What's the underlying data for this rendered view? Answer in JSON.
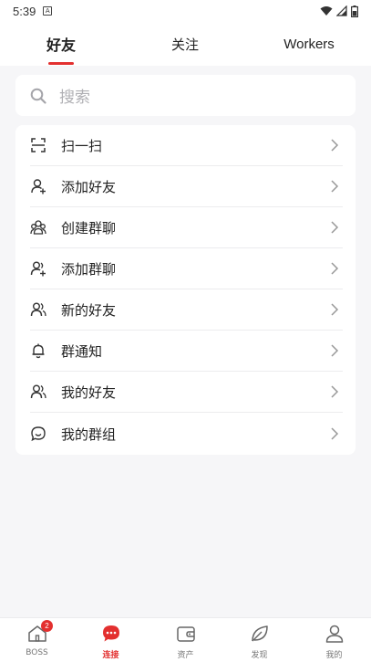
{
  "status_bar": {
    "time": "5:39",
    "notification_glyph": "A"
  },
  "tabs": [
    {
      "label": "好友",
      "active": true
    },
    {
      "label": "关注",
      "active": false
    },
    {
      "label": "Workers",
      "active": false
    }
  ],
  "search": {
    "placeholder": "搜索"
  },
  "menu": [
    {
      "label": "扫一扫",
      "icon": "scan-icon"
    },
    {
      "label": "添加好友",
      "icon": "add-friend-icon"
    },
    {
      "label": "创建群聊",
      "icon": "create-group-icon"
    },
    {
      "label": "添加群聊",
      "icon": "add-group-icon"
    },
    {
      "label": "新的好友",
      "icon": "new-friends-icon"
    },
    {
      "label": "群通知",
      "icon": "bell-icon"
    },
    {
      "label": "我的好友",
      "icon": "my-friends-icon"
    },
    {
      "label": "我的群组",
      "icon": "my-groups-icon"
    }
  ],
  "bottom_nav": [
    {
      "label": "BOSS",
      "icon": "home-icon",
      "badge": "2",
      "active": false
    },
    {
      "label": "连接",
      "icon": "chat-icon",
      "active": true
    },
    {
      "label": "资产",
      "icon": "wallet-icon",
      "active": false
    },
    {
      "label": "发现",
      "icon": "leaf-icon",
      "active": false
    },
    {
      "label": "我的",
      "icon": "person-icon",
      "active": false
    }
  ],
  "colors": {
    "accent": "#e3302f",
    "background": "#f6f6f8",
    "text": "#222222",
    "muted": "#777777"
  }
}
